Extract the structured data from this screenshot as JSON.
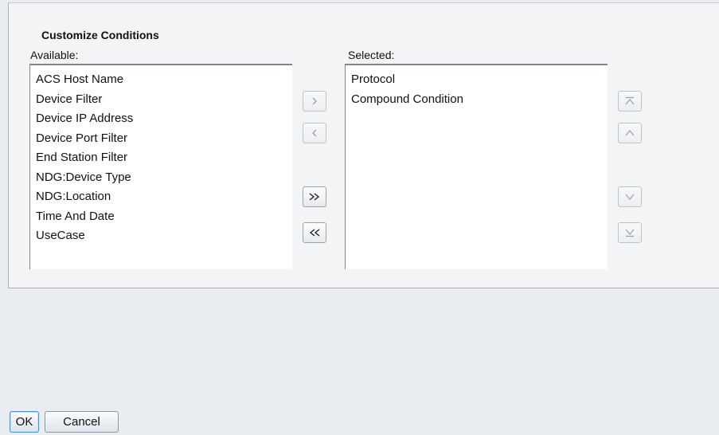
{
  "dialog": {
    "heading": "Customize Conditions",
    "available_label": "Available:",
    "selected_label": "Selected:"
  },
  "available": [
    "ACS Host Name",
    "Device Filter",
    "Device IP Address",
    "Device Port Filter",
    "End Station Filter",
    "NDG:Device Type",
    "NDG:Location",
    "Time And Date",
    "UseCase"
  ],
  "selected": [
    "Protocol",
    "Compound Condition"
  ],
  "transfer_buttons": {
    "move_right": {
      "icon": "chevron-right-icon",
      "enabled": false
    },
    "move_left": {
      "icon": "chevron-left-icon",
      "enabled": false
    },
    "move_all_right": {
      "icon": "double-chevron-right-icon",
      "enabled": true
    },
    "move_all_left": {
      "icon": "double-chevron-left-icon",
      "enabled": true
    }
  },
  "order_buttons": {
    "move_top": {
      "icon": "move-to-top-icon",
      "enabled": false
    },
    "move_up": {
      "icon": "move-up-icon",
      "enabled": false
    },
    "move_down": {
      "icon": "move-down-icon",
      "enabled": false
    },
    "move_bottom": {
      "icon": "move-to-bottom-icon",
      "enabled": false
    }
  },
  "footer": {
    "ok_label": "OK",
    "cancel_label": "Cancel"
  },
  "colors": {
    "enabled_icon": "#222222",
    "disabled_icon": "#9aa3ad"
  }
}
